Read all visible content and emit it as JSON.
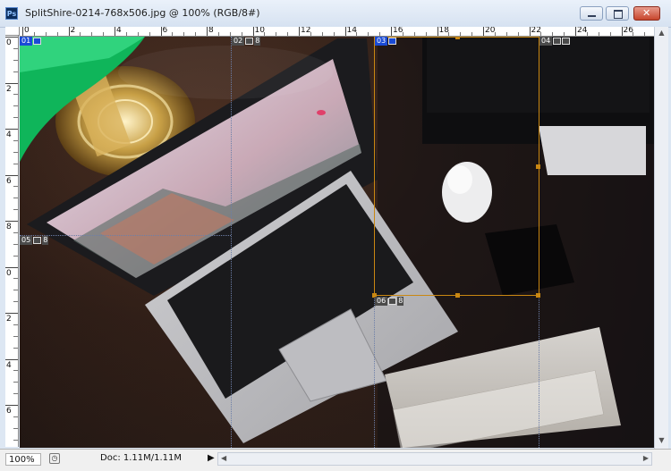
{
  "window": {
    "app_icon": "photoshop-app-icon",
    "app_icon_text": "Ps",
    "title": "SplitShire-0214-768x506.jpg @ 100% (RGB/8#)",
    "controls": [
      "minimize-icon",
      "maximize-icon",
      "close-icon"
    ]
  },
  "ruler_h": [
    "0",
    "2",
    "4",
    "6",
    "8",
    "10",
    "12",
    "14",
    "16",
    "18",
    "20",
    "22",
    "24",
    "26"
  ],
  "ruler_v": [
    "0",
    "2",
    "4",
    "6",
    "8",
    "0",
    "2",
    "4",
    "6"
  ],
  "slices": [
    {
      "num": "01",
      "active": true
    },
    {
      "num": "02",
      "active": false
    },
    {
      "num": "03",
      "active": true
    },
    {
      "num": "04",
      "active": false
    },
    {
      "num": "05",
      "active": false,
      "extra": "8"
    },
    {
      "num": "06",
      "active": false,
      "extra": "8"
    }
  ],
  "slice_02_extra": "8",
  "statusbar": {
    "zoom": "100%",
    "doc_info": "Doc: 1.11M/1.11M",
    "menu_arrow": "▶"
  },
  "colors": {
    "selection": "#c98712",
    "active_slice": "#1a4bd6",
    "slice_line": "#6d7fa8"
  }
}
